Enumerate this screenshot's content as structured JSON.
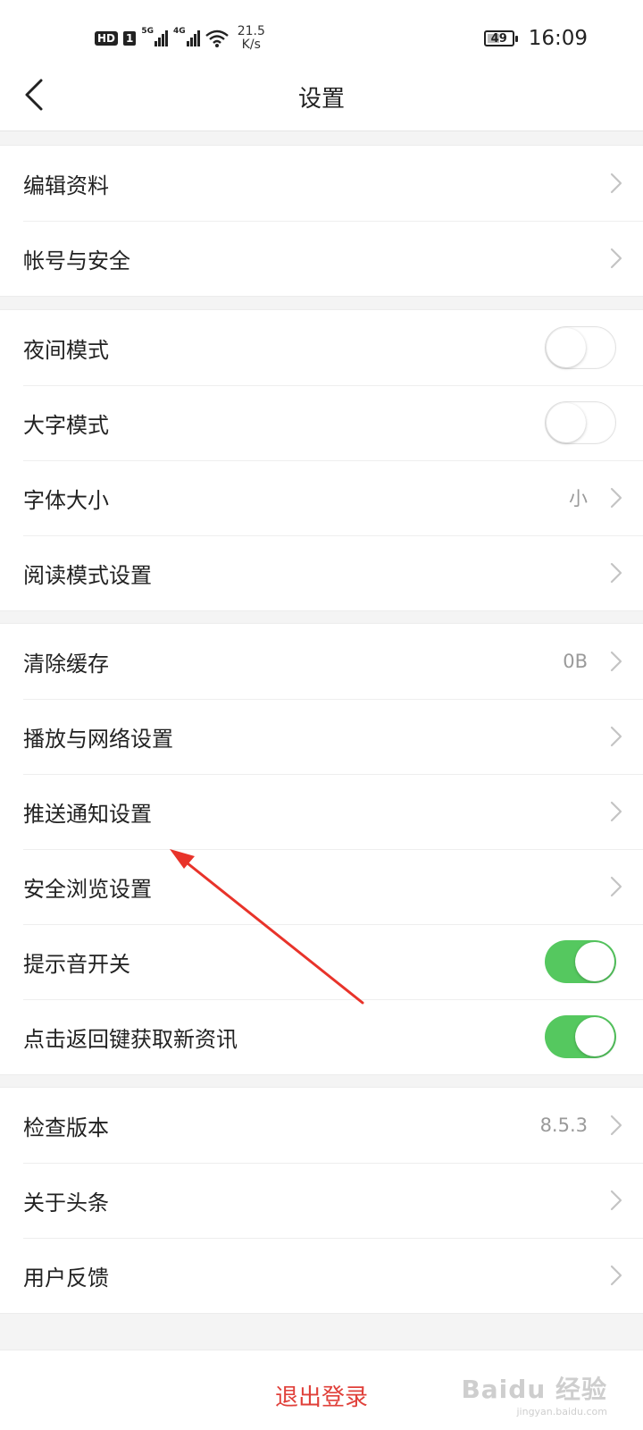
{
  "status_bar": {
    "hd": "HD",
    "sim": "1",
    "net1": "5G",
    "net2": "4G",
    "speed_value": "21.5",
    "speed_unit": "K/s",
    "battery": "49",
    "battery_level_percent": 49,
    "time": "16:09"
  },
  "nav": {
    "title": "设置",
    "back_icon": "chevron-left-icon"
  },
  "groups": [
    {
      "items": [
        {
          "label": "编辑资料",
          "type": "link"
        },
        {
          "label": "帐号与安全",
          "type": "link"
        }
      ]
    },
    {
      "items": [
        {
          "label": "夜间模式",
          "type": "toggle",
          "on": false
        },
        {
          "label": "大字模式",
          "type": "toggle",
          "on": false
        },
        {
          "label": "字体大小",
          "type": "link",
          "value": "小"
        },
        {
          "label": "阅读模式设置",
          "type": "link"
        }
      ]
    },
    {
      "items": [
        {
          "label": "清除缓存",
          "type": "link",
          "value": "0B"
        },
        {
          "label": "播放与网络设置",
          "type": "link"
        },
        {
          "label": "推送通知设置",
          "type": "link"
        },
        {
          "label": "安全浏览设置",
          "type": "link"
        },
        {
          "label": "提示音开关",
          "type": "toggle",
          "on": true
        },
        {
          "label": "点击返回键获取新资讯",
          "type": "toggle",
          "on": true
        }
      ]
    },
    {
      "items": [
        {
          "label": "检查版本",
          "type": "link",
          "value": "8.5.3"
        },
        {
          "label": "关于头条",
          "type": "link"
        },
        {
          "label": "用户反馈",
          "type": "link"
        }
      ]
    }
  ],
  "logout_label": "退出登录",
  "watermark": {
    "main": "Baidu 经验",
    "sub": "jingyan.baidu.com"
  },
  "colors": {
    "toggle_on": "#55c85f",
    "logout": "#e0403a",
    "annotation_arrow": "#e8332a"
  }
}
